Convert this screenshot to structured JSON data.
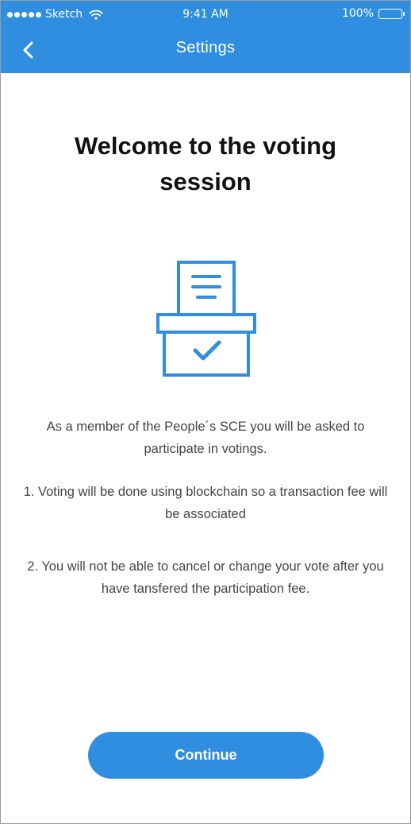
{
  "status_bar": {
    "carrier": "Sketch",
    "time": "9:41 AM",
    "battery": "100%"
  },
  "nav": {
    "back_icon": "chevron-left-icon",
    "title": "Settings"
  },
  "main": {
    "title": "Welcome to the voting session",
    "illustration_icon": "ballot-box-icon",
    "paragraphs": [
      "As a member of the People´s SCE you will be asked to participate in votings.",
      "1. Voting will be done using blockchain so a transaction fee will be associated",
      "2. You will not be able to cancel or change your vote after you have tansfered the participation fee."
    ],
    "continue_label": "Continue"
  },
  "colors": {
    "accent": "#2f8ee0",
    "title_text": "#111111",
    "body_text": "#444444"
  }
}
